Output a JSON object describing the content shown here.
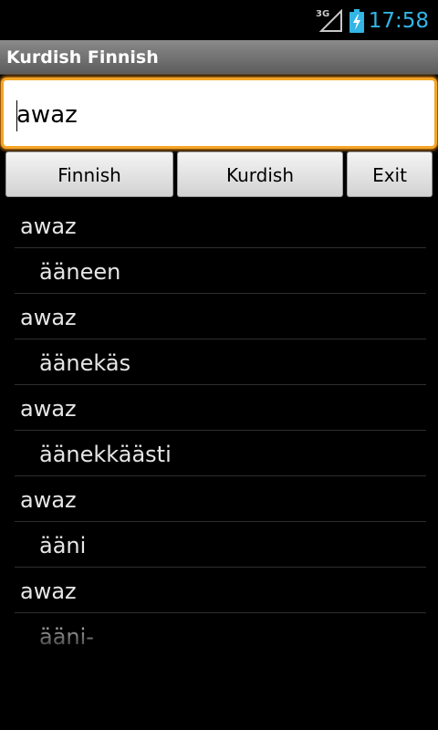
{
  "status_bar": {
    "network": "3G",
    "time": "17:58",
    "icons": [
      "signal-icon",
      "battery-charging-icon"
    ]
  },
  "title_bar": {
    "title": "Kurdish Finnish"
  },
  "search": {
    "value": "awaz"
  },
  "buttons": {
    "finnish": "Finnish",
    "kurdish": "Kurdish",
    "exit": "Exit"
  },
  "results": [
    {
      "term": "awaz",
      "translation": "ääneen"
    },
    {
      "term": "awaz",
      "translation": "äänekäs"
    },
    {
      "term": "awaz",
      "translation": "äänekkäästi"
    },
    {
      "term": "awaz",
      "translation": "ääni"
    },
    {
      "term": "awaz",
      "translation": "ääni-"
    }
  ],
  "colors": {
    "accent_time": "#33b5e5",
    "focus_border": "#f5a526"
  }
}
